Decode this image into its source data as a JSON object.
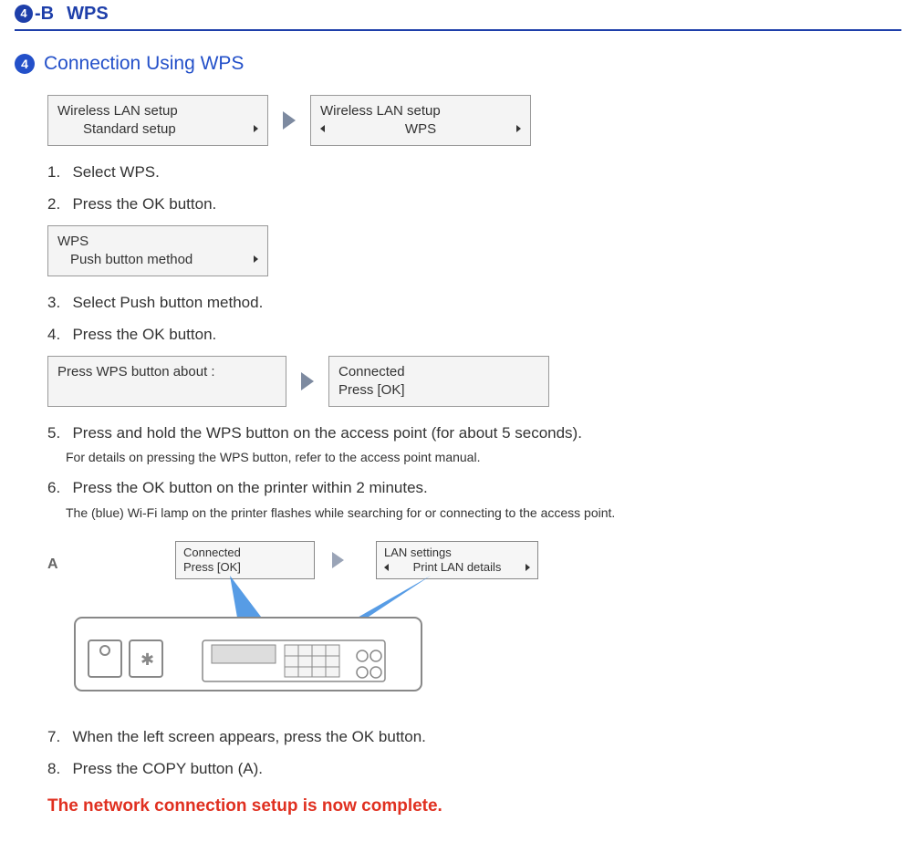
{
  "header": {
    "badge_number": "4",
    "badge_suffix": "-B",
    "title": "WPS"
  },
  "section": {
    "step_number": "4",
    "title": "Connection Using WPS"
  },
  "screens": {
    "wlan_setup_l1": "Wireless LAN setup",
    "standard_setup": "Standard setup",
    "wps_option": "WPS",
    "wps_l1": "WPS",
    "push_button_method": "Push button method",
    "press_wps_about": "Press WPS button about :",
    "connected": "Connected",
    "press_ok": "Press [OK]",
    "lan_settings": "LAN settings",
    "print_lan_details": "Print LAN details"
  },
  "steps": {
    "s1": "Select WPS.",
    "s2": "Press the OK button.",
    "s3": "Select Push button method.",
    "s4": "Press the OK button.",
    "s5": "Press and hold the WPS button on the access point (for about 5 seconds).",
    "s5_note": "For details on pressing the WPS button, refer to the access point manual.",
    "s6": "Press the OK button on the printer within 2 minutes.",
    "s6_note": "The (blue) Wi-Fi lamp on the printer flashes while searching for or connecting to the access point.",
    "s7": "When the left screen appears, press the OK button.",
    "s8": "Press the COPY button (A)."
  },
  "labels": {
    "A": "A"
  },
  "complete": "The network connection setup is now complete."
}
